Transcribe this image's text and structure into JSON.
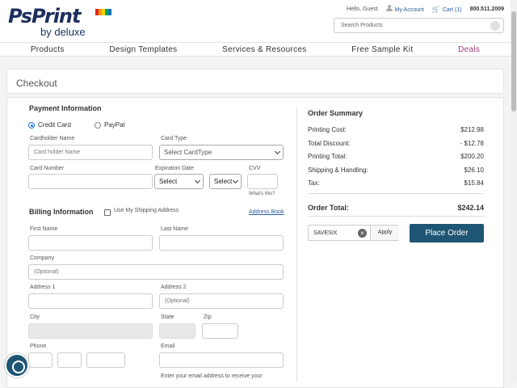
{
  "logo": {
    "brand": "PsPrint",
    "sub": "by deluxe"
  },
  "utility": {
    "greeting": "Hello, Guest",
    "account": "My Account",
    "cart": "Cart (1)",
    "phone": "800.511.2009"
  },
  "search": {
    "placeholder": "Search Products"
  },
  "nav": [
    "Products",
    "Design Templates",
    "Services & Resources",
    "Free Sample Kit",
    "Deals"
  ],
  "page": {
    "title": "Checkout"
  },
  "payment": {
    "title": "Payment Information",
    "credit_card": "Credit Card",
    "paypal": "PayPal",
    "cardholder_label": "Cardholder Name",
    "cardholder_placeholder": "Card holder Name",
    "cardtype_label": "Card Type",
    "cardtype_value": "Select CardType",
    "cardnumber_label": "Card Number",
    "expiration_label": "Expiration Date",
    "exp_month": "Select",
    "exp_year": "Select",
    "cvv_label": "CVV",
    "cvv_help": "What's this?"
  },
  "billing": {
    "title": "Billing Information",
    "use_shipping": "Use My Shipping Address",
    "address_book": "Address Book",
    "first_name": "First Name",
    "last_name": "Last Name",
    "company": "Company",
    "company_placeholder": "(Optional)",
    "address1": "Address 1",
    "address2": "Address 2",
    "address2_placeholder": "(Optional)",
    "city": "City",
    "state": "State",
    "zip": "Zip",
    "phone": "Phone",
    "email": "Email",
    "email_help": "Enter your email address to receive your"
  },
  "order_summary": {
    "title": "Order Summary",
    "rows": [
      {
        "label": "Printing Cost:",
        "value": "$212.98"
      },
      {
        "label": "Total Discount:",
        "value": "- $12.78"
      },
      {
        "label": "Printing Total:",
        "value": "$200.20"
      },
      {
        "label": "Shipping & Handling:",
        "value": "$26.10"
      },
      {
        "label": "Tax:",
        "value": "$15.84"
      }
    ],
    "total_label": "Order Total:",
    "total_value": "$242.14",
    "promo_code": "SAVESIX",
    "apply": "Apply",
    "place_order": "Place Order"
  }
}
